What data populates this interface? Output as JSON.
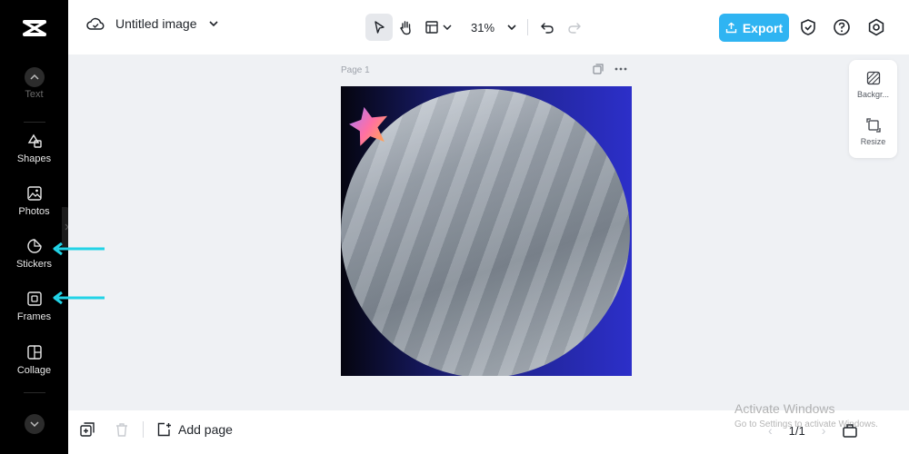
{
  "app": {
    "doc_title": "Untitled image",
    "zoom": "31%",
    "export_label": "Export"
  },
  "sidebar": {
    "items": [
      {
        "label": "Text"
      },
      {
        "label": "Shapes"
      },
      {
        "label": "Photos"
      },
      {
        "label": "Stickers"
      },
      {
        "label": "Frames"
      },
      {
        "label": "Collage"
      }
    ]
  },
  "canvas": {
    "page_label": "Page 1"
  },
  "right_panel": {
    "background_label": "Backgr...",
    "resize_label": "Resize"
  },
  "bottom": {
    "add_page_label": "Add page",
    "page_counter": "1/1"
  },
  "watermark": {
    "title": "Activate Windows",
    "subtitle": "Go to Settings to activate Windows."
  },
  "colors": {
    "accent": "#2fb4f2",
    "sidebar_bg": "#000000",
    "workspace_bg": "#eff1f4",
    "annotation_arrow": "#22d3e6"
  }
}
